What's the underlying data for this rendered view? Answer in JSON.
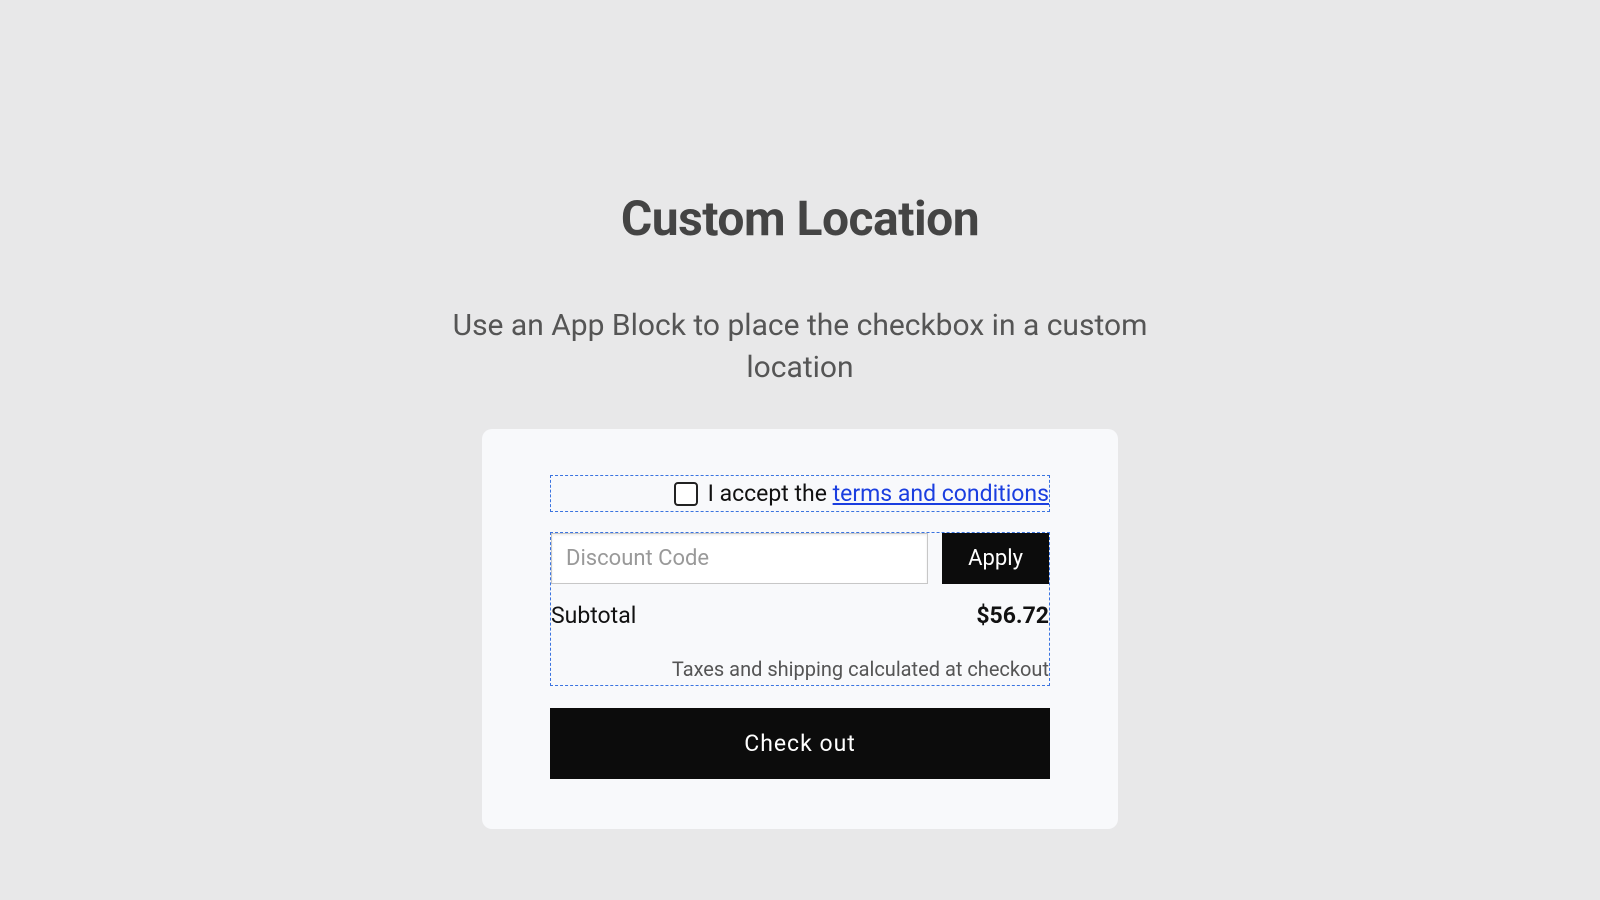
{
  "header": {
    "title": "Custom Location",
    "subtitle": "Use an App Block to place the checkbox in a custom location"
  },
  "terms": {
    "prefix": "I accept the ",
    "link_text": "terms and conditions"
  },
  "discount": {
    "placeholder": "Discount Code",
    "apply_label": "Apply"
  },
  "subtotal": {
    "label": "Subtotal",
    "value": "$56.72"
  },
  "tax_note": "Taxes and shipping calculated at checkout",
  "checkout_label": "Check out"
}
